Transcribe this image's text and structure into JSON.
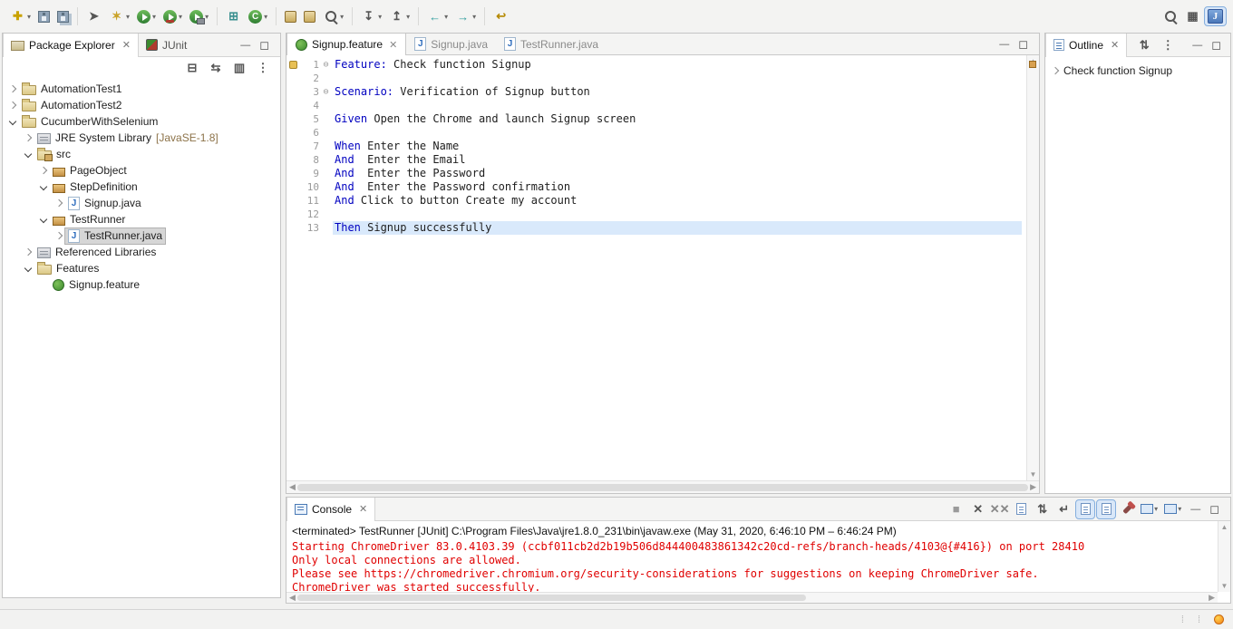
{
  "colors": {
    "kw": "#0000C0",
    "err": "#E00000",
    "curline": "#D9E9FB",
    "accent": "#4A7AB5"
  },
  "toolbar": {
    "items": [
      {
        "name": "new-button",
        "icon": "new-icon",
        "glyph": "✚",
        "color": "#c9a200",
        "dropdown": true,
        "label": "New"
      },
      {
        "name": "save-button",
        "icon": "save-icon",
        "css": "flop",
        "label": "Save"
      },
      {
        "name": "save-all-button",
        "icon": "save-all-icon",
        "css": "flop flop2",
        "label": "Save All"
      },
      {
        "sep": true
      },
      {
        "name": "selection-tool-button",
        "icon": "cursor-icon",
        "glyph": "➤",
        "color": "#555555",
        "label": "Select"
      },
      {
        "name": "new-wizard-button",
        "icon": "wand-icon",
        "glyph": "✶",
        "color": "#c9a227",
        "dropdown": true,
        "label": "New Wizard"
      },
      {
        "name": "run-button",
        "icon": "run-icon",
        "css": "runico",
        "dropdown": true,
        "label": "Run"
      },
      {
        "name": "coverage-button",
        "icon": "coverage-icon",
        "css": "runico covico",
        "dropdown": true,
        "label": "Coverage"
      },
      {
        "name": "external-tools-button",
        "icon": "external-tools-icon",
        "css": "runico extico",
        "dropdown": true,
        "label": "Run External Tools"
      },
      {
        "sep": true
      },
      {
        "name": "new-java-project-button",
        "icon": "new-java-project-icon",
        "glyph": "⊞",
        "color": "#3a8f8f",
        "label": "New Java Project"
      },
      {
        "name": "new-class-button",
        "icon": "new-class-icon",
        "css": "classico",
        "glyph": "C",
        "dropdown": true,
        "label": "New Java Class"
      },
      {
        "sep": true
      },
      {
        "name": "open-archive-button",
        "icon": "jar-icon",
        "css": "jaricon",
        "label": "Open Archive"
      },
      {
        "name": "export-archive-button",
        "icon": "jar-export-icon",
        "css": "jaricon",
        "label": "Export Archive"
      },
      {
        "name": "search-button",
        "icon": "search-icon",
        "css": "mag",
        "dropdown": true,
        "label": "Search"
      },
      {
        "sep": true
      },
      {
        "name": "next-annotation-button",
        "icon": "next-annotation-icon",
        "glyph": "↧",
        "color": "#555555",
        "dropdown": true,
        "label": "Next Annotation"
      },
      {
        "name": "previous-annotation-button",
        "icon": "previous-annotation-icon",
        "glyph": "↥",
        "color": "#555555",
        "dropdown": true,
        "label": "Previous Annotation"
      },
      {
        "sep": true
      },
      {
        "name": "back-button",
        "icon": "back-arrow-icon",
        "glyph": "←",
        "color": "#2e9d9d",
        "dropdown": true,
        "label": "Back"
      },
      {
        "name": "forward-button",
        "icon": "forward-arrow-icon",
        "glyph": "→",
        "color": "#2e9d9d",
        "dropdown": true,
        "label": "Forward"
      },
      {
        "sep": true
      },
      {
        "name": "last-edit-location-button",
        "icon": "last-edit-location-icon",
        "glyph": "↩",
        "color": "#b58900",
        "label": "Last Edit Location"
      }
    ],
    "right_items": [
      {
        "name": "quick-access-search-button",
        "icon": "search-icon",
        "css": "mag",
        "label": "Search"
      },
      {
        "name": "open-perspective-button",
        "icon": "open-perspective-icon",
        "glyph": "▦",
        "color": "#555555",
        "label": "Open Perspective"
      },
      {
        "name": "java-perspective-button",
        "icon": "java-perspective-icon",
        "css": "javapersp",
        "glyph": "J",
        "selected": true,
        "label": "Java Perspective"
      }
    ]
  },
  "explorer": {
    "tabs": [
      {
        "label": "Package Explorer",
        "icon": "package-explorer",
        "active": true,
        "closable": true
      },
      {
        "label": "JUnit",
        "icon": "junit",
        "active": false
      }
    ],
    "toolbar": [
      {
        "name": "collapse-all-button",
        "icon": "collapse-all-icon",
        "glyph": "⊟",
        "color": "#555555",
        "label": "Collapse All"
      },
      {
        "name": "link-with-editor-button",
        "icon": "link-with-editor-icon",
        "glyph": "⇆",
        "color": "#555555",
        "label": "Link with Editor"
      },
      {
        "name": "focus-button",
        "icon": "focus-icon",
        "glyph": "▥",
        "color": "#555555",
        "label": "Focus"
      },
      {
        "name": "view-menu-button",
        "icon": "view-menu-icon",
        "glyph": "⋮",
        "color": "#555555",
        "label": "View Menu"
      }
    ],
    "tree": [
      {
        "depth": 0,
        "arrow": "right",
        "icon": "project",
        "label": "AutomationTest1"
      },
      {
        "depth": 0,
        "arrow": "right",
        "icon": "project",
        "label": "AutomationTest2"
      },
      {
        "depth": 0,
        "arrow": "down",
        "icon": "project",
        "label": "CucumberWithSelenium"
      },
      {
        "depth": 1,
        "arrow": "right",
        "icon": "jre",
        "label": "JRE System Library",
        "suffix": " [JavaSE-1.8]"
      },
      {
        "depth": 1,
        "arrow": "down",
        "icon": "src",
        "label": "src"
      },
      {
        "depth": 2,
        "arrow": "right",
        "icon": "package",
        "label": "PageObject"
      },
      {
        "depth": 2,
        "arrow": "down",
        "icon": "package",
        "label": "StepDefinition"
      },
      {
        "depth": 3,
        "arrow": "right",
        "icon": "java",
        "label": "Signup.java"
      },
      {
        "depth": 2,
        "arrow": "down",
        "icon": "package",
        "label": "TestRunner"
      },
      {
        "depth": 3,
        "arrow": "right",
        "icon": "java",
        "label": "TestRunner.java",
        "selected": true
      },
      {
        "depth": 1,
        "arrow": "right",
        "icon": "lib",
        "label": "Referenced Libraries"
      },
      {
        "depth": 1,
        "arrow": "down",
        "icon": "folder",
        "label": "Features"
      },
      {
        "depth": 2,
        "arrow": "none",
        "icon": "feature",
        "label": "Signup.feature"
      }
    ]
  },
  "editor": {
    "tabs": [
      {
        "label": "Signup.feature",
        "icon": "feature",
        "active": true,
        "closable": true
      },
      {
        "label": "Signup.java",
        "icon": "java",
        "active": false
      },
      {
        "label": "TestRunner.java",
        "icon": "java",
        "active": false
      }
    ],
    "lines": [
      {
        "num": "1",
        "fold": true,
        "marker": "feature",
        "segments": [
          {
            "t": "Feature:",
            "c": "kw"
          },
          {
            "t": " Check function Signup",
            "c": ""
          }
        ]
      },
      {
        "num": "2",
        "segments": []
      },
      {
        "num": "3",
        "fold": true,
        "segments": [
          {
            "t": "Scenario:",
            "c": "kw"
          },
          {
            "t": " Verification of Signup button",
            "c": ""
          }
        ]
      },
      {
        "num": "4",
        "segments": []
      },
      {
        "num": "5",
        "segments": [
          {
            "t": "Given",
            "c": "kw"
          },
          {
            "t": " Open the Chrome and launch Signup screen",
            "c": ""
          }
        ]
      },
      {
        "num": "6",
        "segments": []
      },
      {
        "num": "7",
        "segments": [
          {
            "t": "When",
            "c": "kw"
          },
          {
            "t": " Enter the Name",
            "c": ""
          }
        ]
      },
      {
        "num": "8",
        "segments": [
          {
            "t": "And",
            "c": "kw"
          },
          {
            "t": "  Enter the Email",
            "c": ""
          }
        ]
      },
      {
        "num": "9",
        "segments": [
          {
            "t": "And",
            "c": "kw"
          },
          {
            "t": "  Enter the Password",
            "c": ""
          }
        ]
      },
      {
        "num": "10",
        "segments": [
          {
            "t": "And",
            "c": "kw"
          },
          {
            "t": "  Enter the Password confirmation",
            "c": ""
          }
        ]
      },
      {
        "num": "11",
        "segments": [
          {
            "t": "And",
            "c": "kw"
          },
          {
            "t": " Click to button Create my account",
            "c": ""
          }
        ]
      },
      {
        "num": "12",
        "segments": []
      },
      {
        "num": "13",
        "current": true,
        "segments": [
          {
            "t": "Then",
            "c": "kw"
          },
          {
            "t": " Signup successfully",
            "c": ""
          }
        ]
      }
    ]
  },
  "outline": {
    "tabs": [
      {
        "label": "Outline",
        "icon": "outline",
        "active": true,
        "closable": true
      }
    ],
    "toolbar": [
      {
        "name": "sort-button",
        "icon": "sort-icon",
        "glyph": "⇅",
        "color": "#555555",
        "label": "Sort"
      },
      {
        "name": "outline-view-menu-button",
        "icon": "view-menu-icon",
        "glyph": "⋮",
        "color": "#555555",
        "label": "View Menu"
      }
    ],
    "items": [
      {
        "label": "Check function Signup"
      }
    ]
  },
  "console": {
    "tabs": [
      {
        "label": "Console",
        "icon": "console",
        "active": true,
        "closable": true
      }
    ],
    "header": "<terminated> TestRunner [JUnit] C:\\Program Files\\Java\\jre1.8.0_231\\bin\\javaw.exe (May 31, 2020, 6:46:10 PM – 6:46:24 PM)",
    "output_lines": [
      "Starting ChromeDriver 83.0.4103.39 (ccbf011cb2d2b19b506d844400483861342c20cd-refs/branch-heads/4103@{#416}) on port 28410",
      "Only local connections are allowed.",
      "Please see https://chromedriver.chromium.org/security-considerations for suggestions on keeping ChromeDriver safe.",
      "ChromeDriver was started successfully."
    ],
    "toolbar": [
      {
        "name": "terminate-button",
        "icon": "terminate-icon",
        "glyph": "■",
        "color": "#9a9a9a",
        "label": "Terminate"
      },
      {
        "name": "remove-launch-button",
        "icon": "remove-icon",
        "glyph": "✕",
        "color": "#555555",
        "label": "Remove Launch"
      },
      {
        "name": "remove-all-launches-button",
        "icon": "remove-all-icon",
        "glyph": "✕✕",
        "color": "#888888",
        "label": "Remove All Terminated Launches"
      },
      {
        "name": "clear-console-button",
        "icon": "clear-console-icon",
        "css": "docico",
        "label": "Clear Console"
      },
      {
        "name": "scroll-lock-button",
        "icon": "scroll-lock-icon",
        "glyph": "⇅",
        "color": "#555555",
        "label": "Scroll Lock"
      },
      {
        "name": "word-wrap-button",
        "icon": "word-wrap-icon",
        "glyph": "↵",
        "color": "#555555",
        "label": "Word Wrap"
      },
      {
        "name": "show-console-stdout-button",
        "icon": "stdout-console-icon",
        "css": "docico",
        "selected": true,
        "label": "Show Console When Standard Out Changes"
      },
      {
        "name": "show-console-stderr-button",
        "icon": "stderr-console-icon",
        "css": "docico",
        "selected": true,
        "label": "Show Console When Standard Error Changes"
      },
      {
        "name": "pin-console-button",
        "icon": "pin-icon",
        "css": "pinico",
        "label": "Pin Console"
      },
      {
        "name": "display-selected-console-button",
        "icon": "display-console-icon",
        "css": "monico",
        "dropdown": true,
        "label": "Display Selected Console"
      },
      {
        "name": "open-console-button",
        "icon": "open-console-icon",
        "css": "monico",
        "dropdown": true,
        "label": "Open Console"
      }
    ]
  }
}
